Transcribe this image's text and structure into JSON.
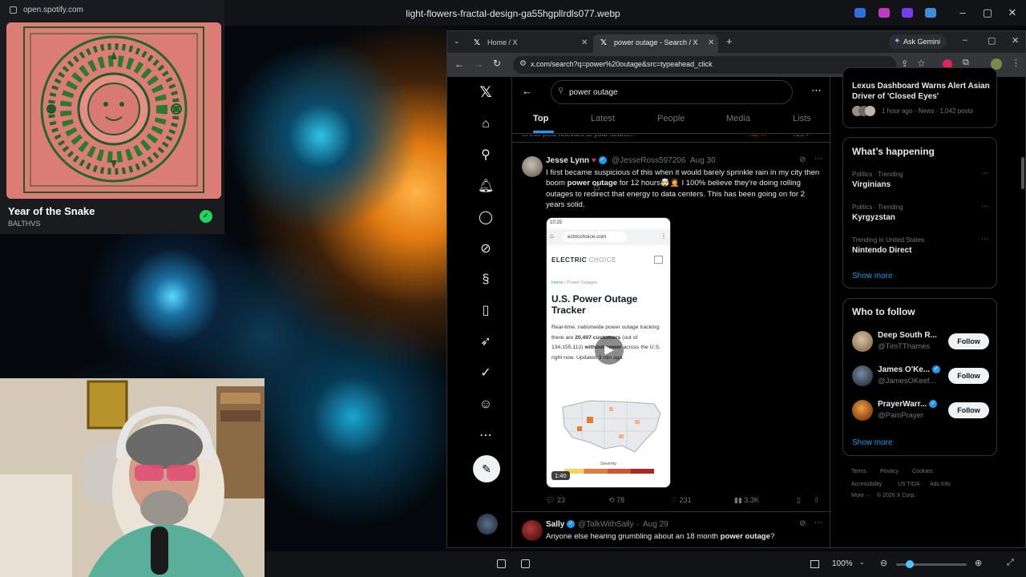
{
  "viewer": {
    "title": "light-flowers-fractal-design-ga55hgpllrdls077.webp",
    "zoom": "100%"
  },
  "spotify": {
    "url": "open.spotify.com",
    "track_title": "Year of the Snake",
    "artist": "BALTHVS"
  },
  "browser": {
    "tabs": [
      {
        "label": "Home / X",
        "active": false
      },
      {
        "label": "power outage - Search / X",
        "active": true
      }
    ],
    "gemini_label": "Ask Gemini",
    "url": "x.com/search?q=power%20outage&src=typeahead_click"
  },
  "x": {
    "search_query": "power outage",
    "search_tabs": [
      "Top",
      "Latest",
      "People",
      "Media",
      "Lists"
    ],
    "relevance_prompt": "Is this post relevant to your search?",
    "relevance_no": "No",
    "relevance_yes": "Yes",
    "tweet1": {
      "name": "Jesse Lynn",
      "handle": "@JesseRoss597206",
      "date": "Aug 30",
      "text_before": "I first became suspicious of this when it would barely sprinkle rain in my city then boom",
      "text_bold": "power outage",
      "text_after": "for 12 hours🤯🤦 I 100% believe they're doing rolling outages to redirect that energy to data centers. This has been going on for 2 years solid.",
      "media": {
        "time": "10:25",
        "site": "ectricchoice.com",
        "brand_a": "ELECTRIC",
        "brand_b": "CHOICE",
        "crumb_home": "Home",
        "crumb_page": "Power Outages",
        "heading": "U.S. Power Outage Tracker",
        "body_a": "Real-time, nationwide power outage tracking: there are",
        "body_count": "20,407 customers",
        "body_b": "(out of 134,155,112)",
        "body_bold2": "without power",
        "body_c": "across the U.S. right now. Updated 3 min ago.",
        "severity_label": "Severity",
        "duration": "1:40"
      },
      "replies": "23",
      "reposts": "78",
      "likes": "231",
      "views": "3.3K"
    },
    "tweet2": {
      "name": "Sally",
      "handle": "@TalkWithSally",
      "date": "Aug 29",
      "text_before": "Anyone else hearing grumbling about an 18 month",
      "text_bold": "power outage",
      "text_after": "?"
    },
    "news": {
      "title": "Lexus Dashboard Warns Alert Asian Driver of 'Closed Eyes'",
      "meta": "1 hour ago · News · 1,042 posts"
    },
    "whats_happening": {
      "title": "What’s happening",
      "trends": [
        {
          "meta": "Politics · Trending",
          "name": "Virginians"
        },
        {
          "meta": "Politics · Trending",
          "name": "Kyrgyzstan"
        },
        {
          "meta": "Trending in United States",
          "name": "Nintendo Direct"
        }
      ],
      "show_more": "Show more"
    },
    "who_to_follow": {
      "title": "Who to follow",
      "accounts": [
        {
          "name": "Deep South R...",
          "handle": "@TimTThames",
          "button": "Follow"
        },
        {
          "name": "James O'Ke...",
          "handle": "@JamesOKeef...",
          "button": "Follow"
        },
        {
          "name": "PrayerWarr...",
          "handle": "@PamPrayer",
          "button": "Follow"
        }
      ],
      "show_more": "Show more"
    },
    "footer": {
      "terms": "Terms",
      "privacy": "Privacy",
      "cookies": "Cookies",
      "accessibility": "Accessibility",
      "ustida": "US TIDA",
      "ads": "Ads Info",
      "more": "More ···",
      "copyright": "© 2026 X Corp."
    }
  }
}
